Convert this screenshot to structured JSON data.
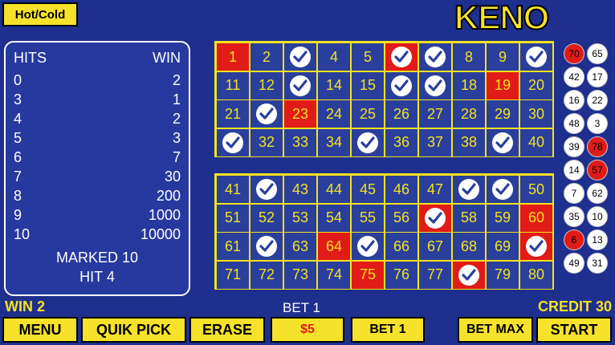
{
  "hot_cold_label": "Hot/Cold",
  "logo_text": "KENO",
  "paytable": {
    "hits_header": "HITS",
    "win_header": "WIN",
    "rows": [
      {
        "hits": "0",
        "win": "2"
      },
      {
        "hits": "3",
        "win": "1"
      },
      {
        "hits": "4",
        "win": "2"
      },
      {
        "hits": "5",
        "win": "3"
      },
      {
        "hits": "6",
        "win": "7"
      },
      {
        "hits": "7",
        "win": "30"
      },
      {
        "hits": "8",
        "win": "200"
      },
      {
        "hits": "9",
        "win": "1000"
      },
      {
        "hits": "10",
        "win": "10000"
      }
    ],
    "marked_text": "MARKED 10",
    "hit_text": "HIT 4"
  },
  "board": {
    "numbers": [
      1,
      2,
      3,
      4,
      5,
      6,
      7,
      8,
      9,
      10,
      11,
      12,
      13,
      14,
      15,
      16,
      17,
      18,
      19,
      20,
      21,
      22,
      23,
      24,
      25,
      26,
      27,
      28,
      29,
      30,
      31,
      32,
      33,
      34,
      35,
      36,
      37,
      38,
      39,
      40,
      41,
      42,
      43,
      44,
      45,
      46,
      47,
      48,
      49,
      50,
      51,
      52,
      53,
      54,
      55,
      56,
      57,
      58,
      59,
      60,
      61,
      62,
      63,
      64,
      65,
      66,
      67,
      68,
      69,
      70,
      71,
      72,
      73,
      74,
      75,
      76,
      77,
      78,
      79,
      80
    ],
    "checked": [
      3,
      6,
      7,
      10,
      13,
      16,
      17,
      22,
      31,
      35,
      39,
      42,
      48,
      49,
      57,
      62,
      65,
      70,
      78
    ],
    "highlighted": [
      1,
      6,
      19,
      23,
      57,
      60,
      64,
      70,
      75,
      78
    ],
    "hit_color": "#e11b17",
    "cell_color": "#2a3f9c",
    "number_color": "#f2e21f"
  },
  "drawn_balls": [
    {
      "n": "70",
      "red": true
    },
    {
      "n": "65",
      "red": false
    },
    {
      "n": "42",
      "red": false
    },
    {
      "n": "17",
      "red": false
    },
    {
      "n": "16",
      "red": false
    },
    {
      "n": "22",
      "red": false
    },
    {
      "n": "48",
      "red": false
    },
    {
      "n": "3",
      "red": false
    },
    {
      "n": "39",
      "red": false
    },
    {
      "n": "78",
      "red": true
    },
    {
      "n": "14",
      "red": false
    },
    {
      "n": "57",
      "red": true
    },
    {
      "n": "7",
      "red": false
    },
    {
      "n": "62",
      "red": false
    },
    {
      "n": "35",
      "red": false
    },
    {
      "n": "10",
      "red": false
    },
    {
      "n": "6",
      "red": true
    },
    {
      "n": "13",
      "red": false
    },
    {
      "n": "49",
      "red": false
    },
    {
      "n": "31",
      "red": false
    }
  ],
  "status": {
    "win_text": "WIN 2",
    "bet_text": "BET 1",
    "credit_text": "CREDIT 30"
  },
  "buttons": {
    "menu": "MENU",
    "quik_pick": "QUIK PICK",
    "erase": "ERASE",
    "denomination": "$5",
    "bet_one": "BET 1",
    "bet_max": "BET MAX",
    "start": "START"
  }
}
